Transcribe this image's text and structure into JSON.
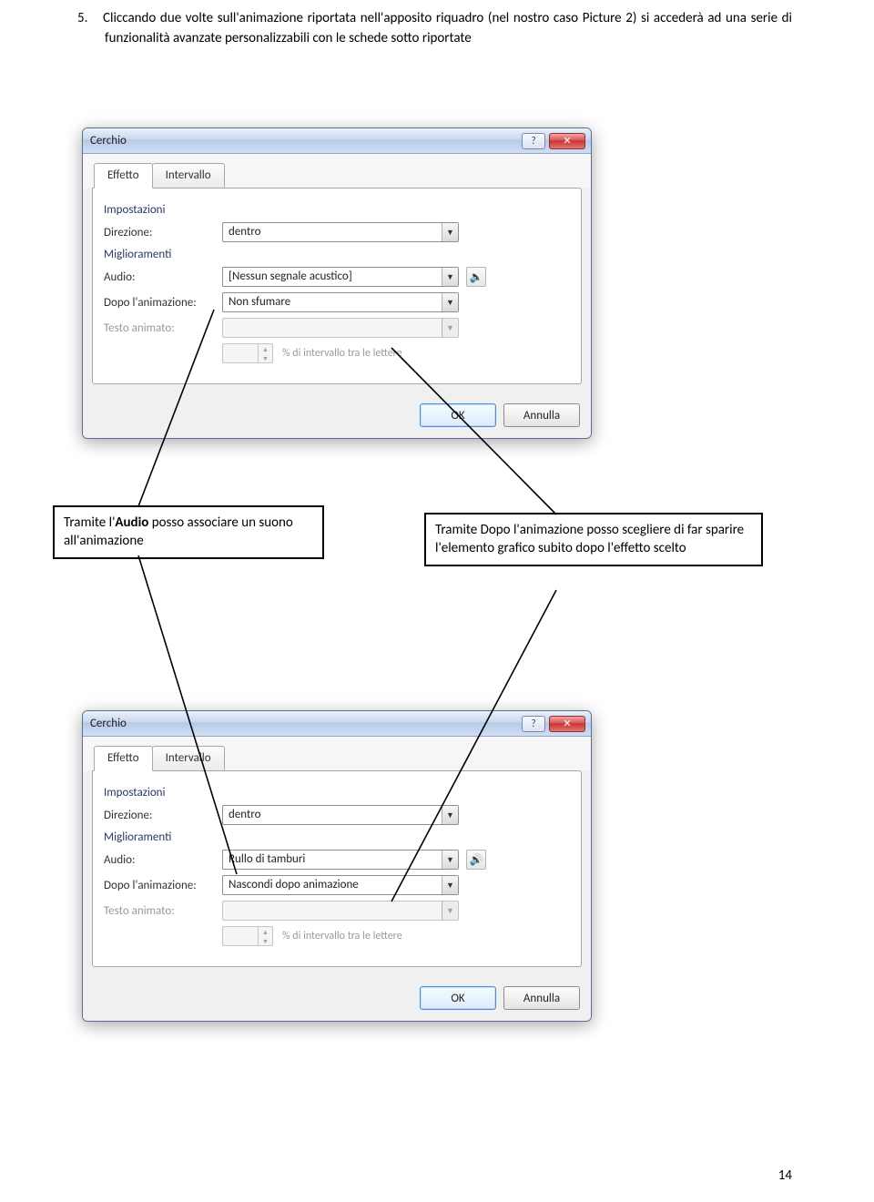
{
  "instruction": {
    "number": "5.",
    "text": "Cliccando due volte sull'animazione riportata nell'apposito riquadro (nel nostro caso Picture 2) si accederà ad una serie di funzionalità avanzate personalizzabili con le schede sotto  riportate"
  },
  "dialog1": {
    "title": "Cerchio",
    "tabs": {
      "effect": "Effetto",
      "interval": "Intervallo"
    },
    "sections": {
      "settings": "Impostazioni",
      "enhancements": "Miglioramenti"
    },
    "labels": {
      "direction": "Direzione:",
      "audio": "Audio:",
      "after_anim": "Dopo l'animazione:",
      "animated_text": "Testo animato:",
      "letters_hint": "% di intervallo tra le lettere"
    },
    "values": {
      "direction": "dentro",
      "audio": "[Nessun segnale acustico]",
      "after_anim": "Non sfumare"
    },
    "buttons": {
      "ok": "OK",
      "cancel": "Annulla"
    }
  },
  "dialog2": {
    "title": "Cerchio",
    "tabs": {
      "effect": "Effetto",
      "interval": "Intervallo"
    },
    "sections": {
      "settings": "Impostazioni",
      "enhancements": "Miglioramenti"
    },
    "labels": {
      "direction": "Direzione:",
      "audio": "Audio:",
      "after_anim": "Dopo l'animazione:",
      "animated_text": "Testo animato:",
      "letters_hint": "% di intervallo tra le lettere"
    },
    "values": {
      "direction": "dentro",
      "audio": "Rullo di tamburi",
      "after_anim": "Nascondi dopo animazione"
    },
    "buttons": {
      "ok": "OK",
      "cancel": "Annulla"
    }
  },
  "callouts": {
    "audio_html": "Tramite l'<b>Audio</b> posso associare un suono all'animazione",
    "after_html": "Tramite Dopo l'animazione posso scegliere di far sparire l'elemento grafico subito dopo l'effetto scelto"
  },
  "page_number": "14"
}
